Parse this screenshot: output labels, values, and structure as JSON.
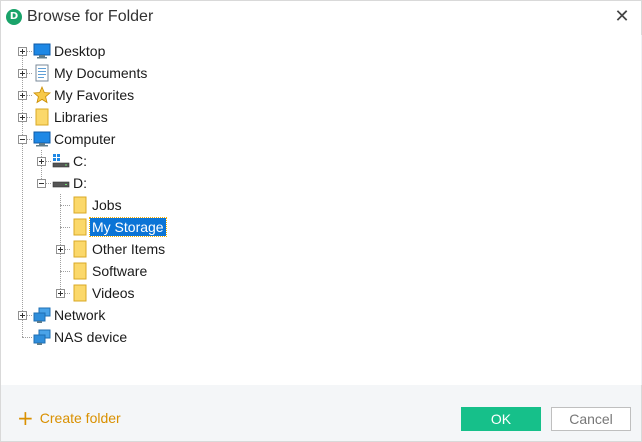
{
  "window": {
    "title": "Browse for Folder"
  },
  "tree": {
    "desktop": "Desktop",
    "my_documents": "My Documents",
    "my_favorites": "My Favorites",
    "libraries": "Libraries",
    "computer": "Computer",
    "drive_c": "C:",
    "drive_d": "D:",
    "jobs": "Jobs",
    "my_storage": "My Storage",
    "other_items": "Other Items",
    "software": "Software",
    "videos": "Videos",
    "network": "Network",
    "nas_device": "NAS device",
    "selected": "My Storage"
  },
  "footer": {
    "create_folder": "Create folder",
    "ok": "OK",
    "cancel": "Cancel"
  },
  "colors": {
    "selection": "#0b74d6",
    "ok_button": "#16c08a",
    "create_link": "#d99000",
    "folder": "#fbd86a"
  }
}
